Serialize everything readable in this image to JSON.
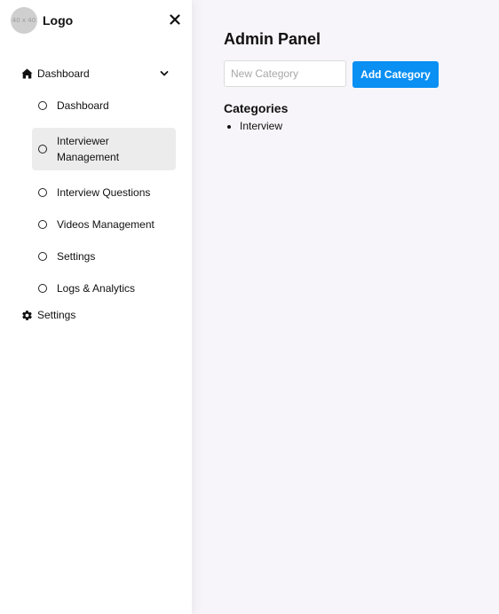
{
  "sidebar": {
    "logo_placeholder": "40 x 40",
    "logo_text": "Logo",
    "close_icon": "close-icon",
    "nav": {
      "parent_label": "Dashboard",
      "parent_icon": "home-icon",
      "expanded_icon": "chevron-down-icon",
      "items": [
        {
          "label": "Dashboard",
          "active": false
        },
        {
          "label": "Interviewer Management",
          "active": true
        },
        {
          "label": "Interview Questions",
          "active": false
        },
        {
          "label": "Videos Management",
          "active": false
        },
        {
          "label": "Settings",
          "active": false
        },
        {
          "label": "Logs & Analytics",
          "active": false
        }
      ]
    },
    "settings": {
      "label": "Settings",
      "icon": "gear-icon"
    }
  },
  "main": {
    "title": "Admin Panel",
    "input": {
      "placeholder": "New Category",
      "value": ""
    },
    "add_button_label": "Add Category",
    "categories_heading": "Categories",
    "categories": [
      "Interview"
    ]
  },
  "colors": {
    "accent": "#0a8ff3",
    "sidebar_bg": "#ffffff",
    "main_bg": "#f7f5f9",
    "active_item_bg": "#ececec"
  }
}
